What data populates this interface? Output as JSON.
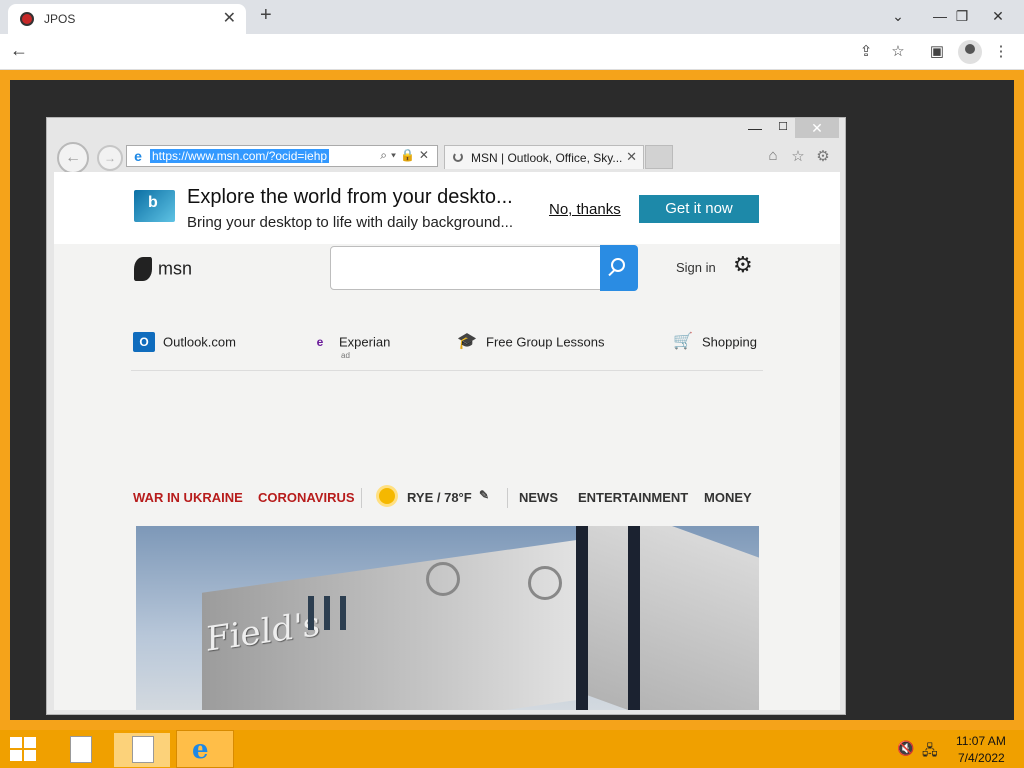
{
  "chrome": {
    "tab_title": "JPOS",
    "tab_close": "✕",
    "new_tab": "+",
    "minimize": "⌄",
    "restore": "—",
    "maximize": "❐",
    "close": "✕",
    "back": "←",
    "share_icon": "⇪",
    "star_icon": "☆",
    "sidebar_icon": "▣",
    "menu_icon": "⋮"
  },
  "ie": {
    "minimize": "—",
    "maximize": "☐",
    "close": "✕",
    "back": "←",
    "forward": "→",
    "url": "https://www.msn.com/?ocid=iehp",
    "address_tools": "⌕▾🔒✕",
    "tab_title": "MSN | Outlook, Office, Sky...",
    "tab_close": "✕",
    "home_icon": "⌂",
    "favorites_icon": "☆",
    "tools_icon": "⚙"
  },
  "promo": {
    "title": "Explore the world from your deskto...",
    "subtitle": "Bring your desktop to life with daily background...",
    "no_thanks": "No, thanks",
    "get_it": "Get it now"
  },
  "msn": {
    "logo_text": "msn",
    "sign_in": "Sign in",
    "settings_icon": "⚙"
  },
  "quick_links": [
    {
      "label": "Outlook.com",
      "icon": "O"
    },
    {
      "label": "Experian",
      "icon": "e"
    },
    {
      "label": "Free Group Lessons",
      "icon": "🎓"
    },
    {
      "label": "Shopping",
      "icon": "🛒"
    }
  ],
  "ad_label": "ad",
  "nav": {
    "ukraine": "WAR IN UKRAINE",
    "coronavirus": "CORONAVIRUS",
    "weather": "RYE / 78°F",
    "edit_icon": "✎",
    "news": "NEWS",
    "entertainment": "ENTERTAINMENT",
    "money": "MONEY"
  },
  "hero": {
    "sign_text": "Field's"
  },
  "taskbar": {
    "ie_icon": "e",
    "volume_icon": "🔇",
    "network_icon": "🖧",
    "time": "11:07 AM",
    "date": "7/4/2022"
  },
  "colors": {
    "accent_orange": "#f5a31a",
    "promo_button": "#1d89a9",
    "search_button": "#2a8ce3",
    "nav_red": "#b71c1c"
  }
}
